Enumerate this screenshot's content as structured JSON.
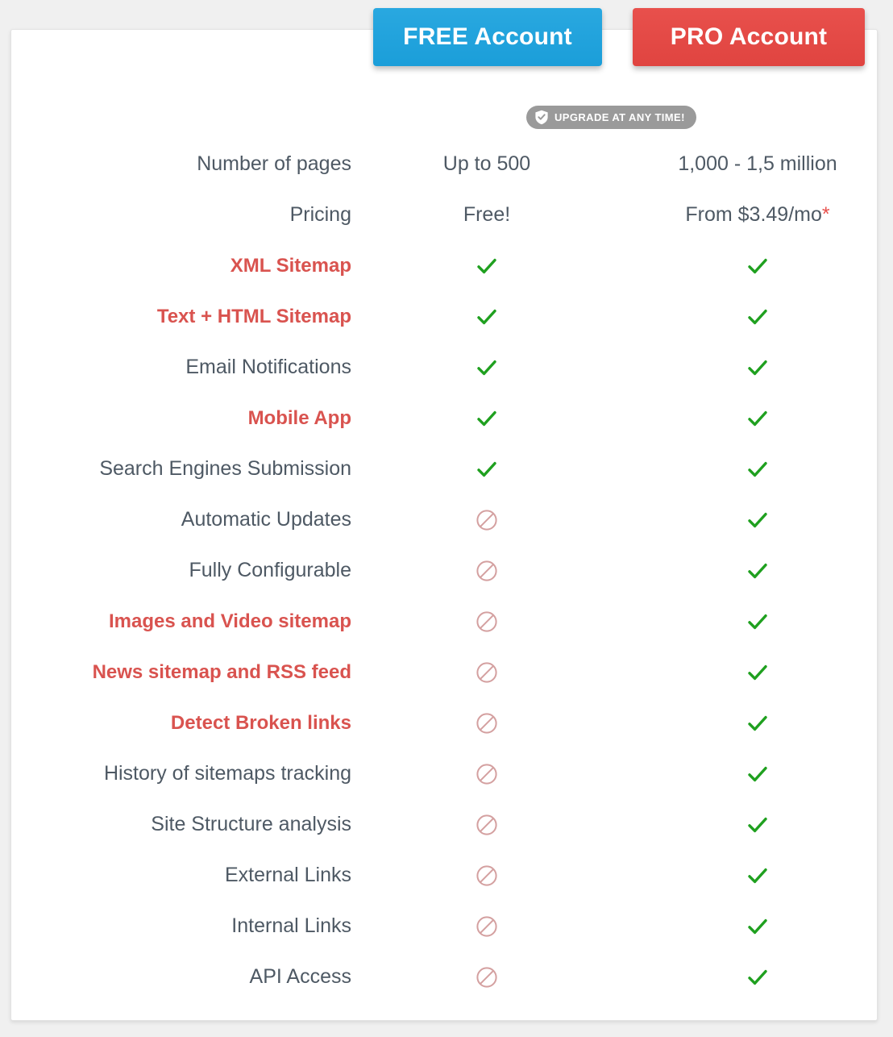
{
  "header": {
    "free_button_label": "FREE Account",
    "pro_button_label": "PRO Account",
    "free_button_color": "#1b9ed9",
    "pro_button_color": "#e04440"
  },
  "badge": {
    "text": "UPGRADE AT ANY TIME!",
    "icon": "shield-check-icon",
    "background_color": "#9a9a9a"
  },
  "colors": {
    "highlight_label": "#d9534f",
    "label": "#4e5964",
    "check": "#1fa01f",
    "ban": "#d4a0a0",
    "page_background": "#f0f0f0",
    "card_background": "#ffffff"
  },
  "table": {
    "rows": [
      {
        "label": "Number of pages",
        "highlight": false,
        "free": "Up to 500",
        "pro": "1,000 - 1,5 million",
        "free_type": "text",
        "pro_type": "text"
      },
      {
        "label": "Pricing",
        "highlight": false,
        "free": "Free!",
        "pro": "From $3.49/mo",
        "pro_suffix": "*",
        "free_type": "text",
        "pro_type": "text"
      },
      {
        "label": "XML Sitemap",
        "highlight": true,
        "free_type": "check",
        "pro_type": "check"
      },
      {
        "label": "Text + HTML Sitemap",
        "highlight": true,
        "free_type": "check",
        "pro_type": "check"
      },
      {
        "label": "Email Notifications",
        "highlight": false,
        "free_type": "check",
        "pro_type": "check"
      },
      {
        "label": "Mobile App",
        "highlight": true,
        "free_type": "check",
        "pro_type": "check"
      },
      {
        "label": "Search Engines Submission",
        "highlight": false,
        "free_type": "check",
        "pro_type": "check"
      },
      {
        "label": "Automatic Updates",
        "highlight": false,
        "free_type": "ban",
        "pro_type": "check"
      },
      {
        "label": "Fully Configurable",
        "highlight": false,
        "free_type": "ban",
        "pro_type": "check"
      },
      {
        "label": "Images and Video sitemap",
        "highlight": true,
        "free_type": "ban",
        "pro_type": "check"
      },
      {
        "label": "News sitemap and RSS feed",
        "highlight": true,
        "free_type": "ban",
        "pro_type": "check"
      },
      {
        "label": "Detect Broken links",
        "highlight": true,
        "free_type": "ban",
        "pro_type": "check"
      },
      {
        "label": "History of sitemaps tracking",
        "highlight": false,
        "free_type": "ban",
        "pro_type": "check"
      },
      {
        "label": "Site Structure analysis",
        "highlight": false,
        "free_type": "ban",
        "pro_type": "check"
      },
      {
        "label": "External Links",
        "highlight": false,
        "free_type": "ban",
        "pro_type": "check"
      },
      {
        "label": "Internal Links",
        "highlight": false,
        "free_type": "ban",
        "pro_type": "check"
      },
      {
        "label": "API Access",
        "highlight": false,
        "free_type": "ban",
        "pro_type": "check"
      }
    ]
  }
}
